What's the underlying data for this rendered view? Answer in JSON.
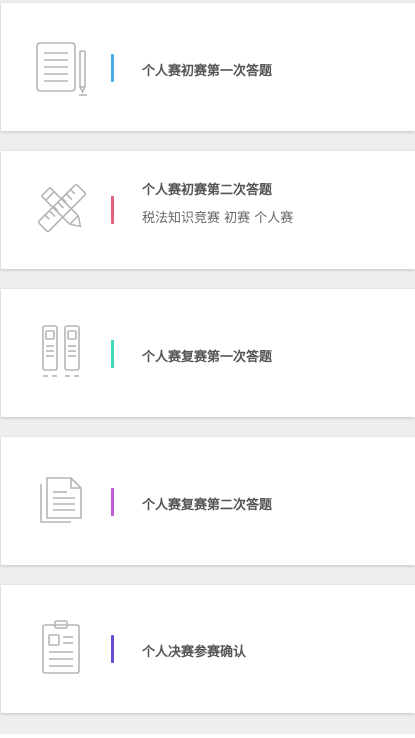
{
  "items": [
    {
      "title": "个人赛初赛第一次答题",
      "bar_color": "#4aa8e8",
      "icon": "notepad-pencil-icon"
    },
    {
      "title": "个人赛初赛第二次答题",
      "subtitle": "税法知识竞赛 初赛 个人赛",
      "bar_color": "#e2607a",
      "icon": "ruler-pencil-icon"
    },
    {
      "title": "个人赛复赛第一次答题",
      "bar_color": "#3fd8b8",
      "icon": "binders-icon"
    },
    {
      "title": "个人赛复赛第二次答题",
      "bar_color": "#c05ad8",
      "icon": "documents-icon"
    },
    {
      "title": "个人决赛参赛确认",
      "bar_color": "#6a4bd8",
      "icon": "clipboard-icon"
    }
  ]
}
